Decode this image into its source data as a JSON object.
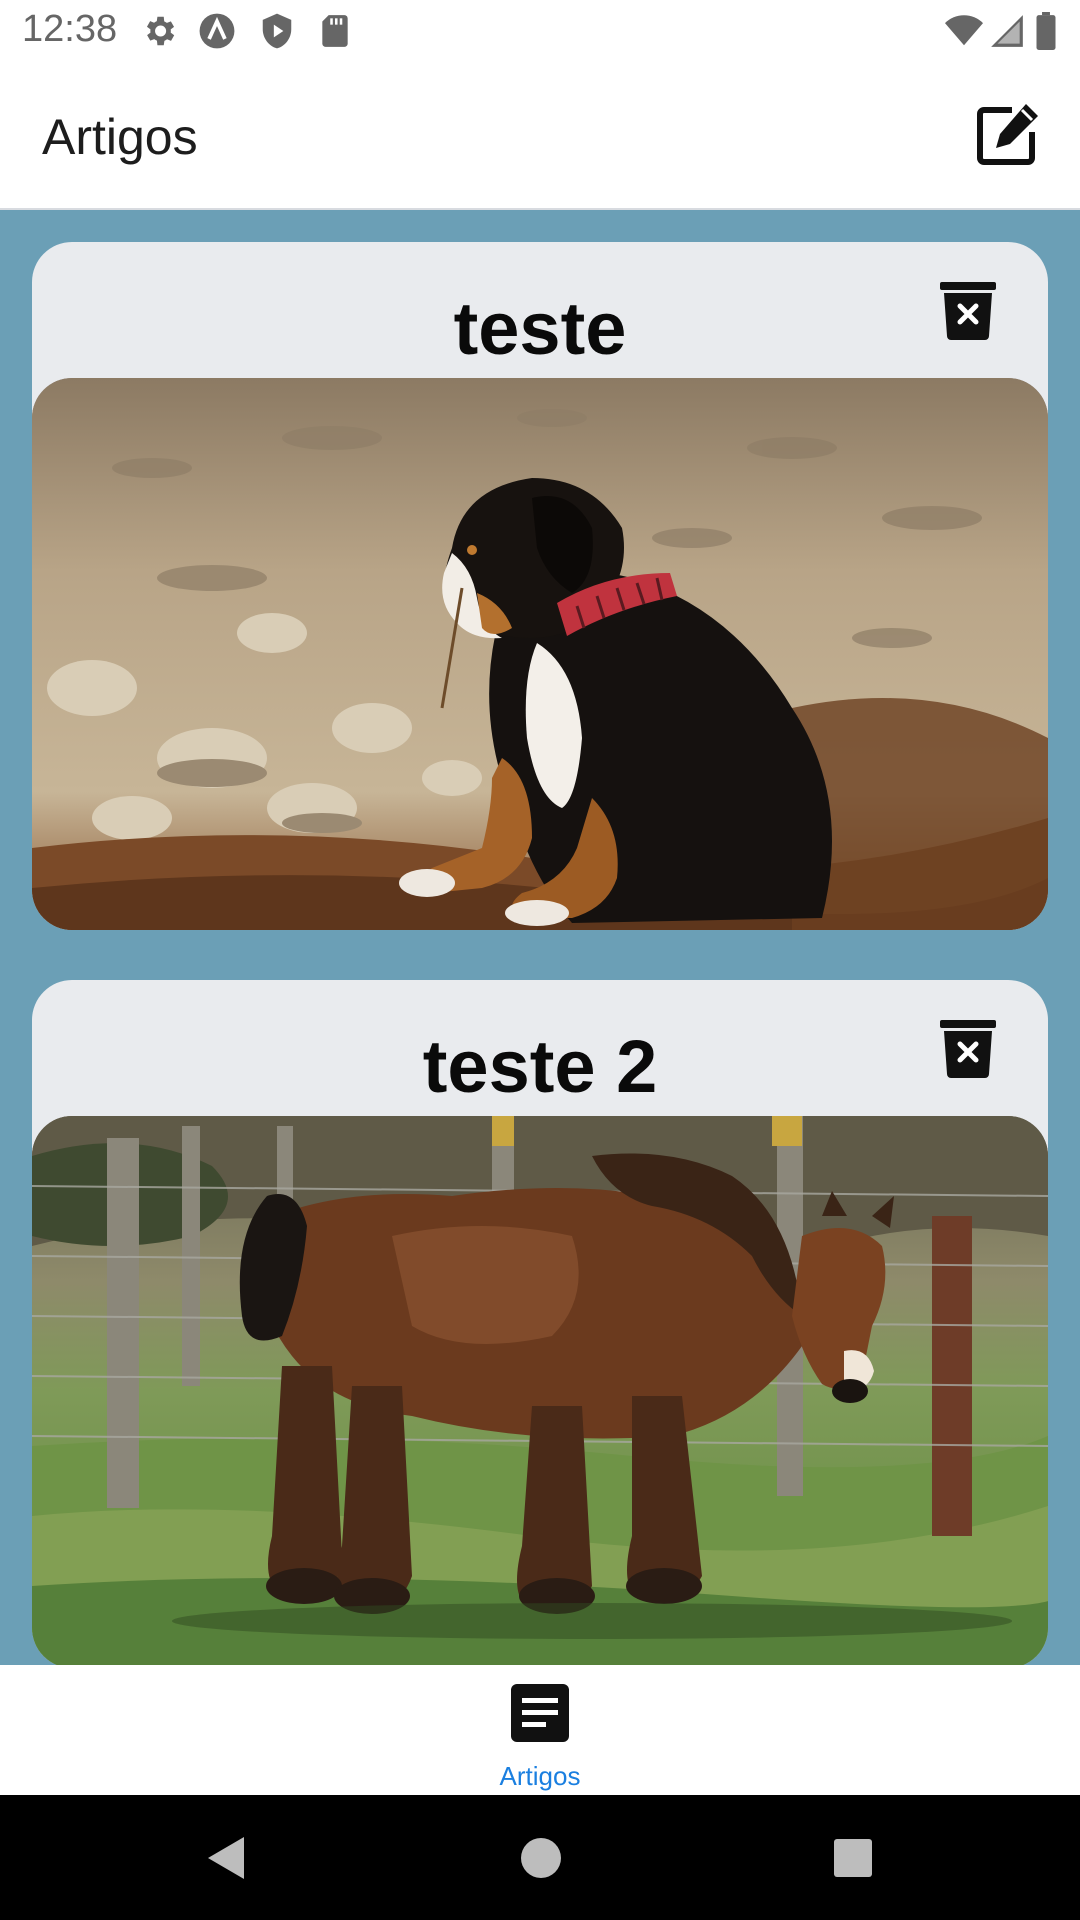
{
  "status_bar": {
    "time": "12:38",
    "left_icons": [
      "gear-icon",
      "a-icon",
      "shield-play-icon",
      "sd-card-icon"
    ],
    "right_icons": [
      "wifi-icon",
      "signal-icon",
      "battery-icon"
    ]
  },
  "app_bar": {
    "title": "Artigos",
    "action_icon": "edit-note-icon"
  },
  "articles": [
    {
      "title": "teste",
      "image": "puppy-photo",
      "delete_icon": "delete-icon"
    },
    {
      "title": "teste 2",
      "image": "horse-photo",
      "delete_icon": "delete-icon"
    }
  ],
  "bottom_nav": {
    "items": [
      {
        "label": "Artigos",
        "icon": "article-icon",
        "active": true
      }
    ]
  },
  "system_nav": [
    "back-icon",
    "home-icon",
    "recents-icon"
  ],
  "colors": {
    "content_bg": "#6b9fb6",
    "card_bg": "#e9ebee",
    "nav_active": "#1a7fe0"
  }
}
